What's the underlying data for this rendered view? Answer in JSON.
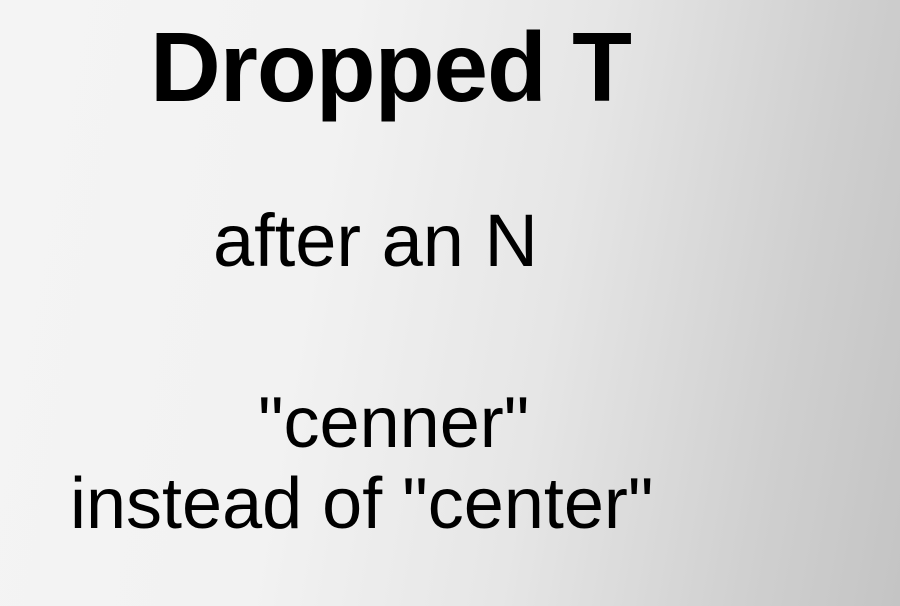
{
  "slide": {
    "title": "Dropped T",
    "subtitle": "after an N",
    "example": "\"cenner\"",
    "explanation": "instead of \"center\""
  }
}
